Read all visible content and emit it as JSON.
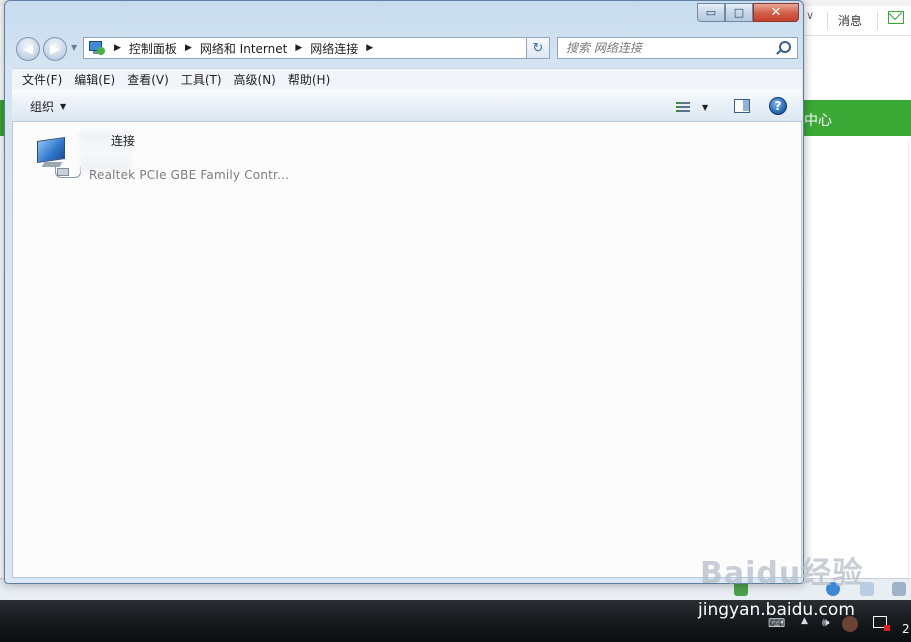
{
  "background": {
    "header_messages": "消息",
    "green_banner_text": "中心",
    "clock_digit": "2",
    "watermark": "Baidu经验",
    "watermark_site": "jingyan.baidu.com"
  },
  "window": {
    "caption": {
      "minimize": "▭",
      "maximize": "□",
      "close": "✕"
    },
    "address": {
      "crumbs": [
        "控制面板",
        "网络和 Internet",
        "网络连接"
      ]
    },
    "search": {
      "placeholder": "搜索 网络连接"
    },
    "menu": [
      "文件(F)",
      "编辑(E)",
      "查看(V)",
      "工具(T)",
      "高级(N)",
      "帮助(H)"
    ],
    "toolbar": {
      "organize_label": "组织",
      "help_label": "?"
    },
    "items": [
      {
        "name": "连接",
        "device": "Realtek PCIe GBE Family Contr..."
      }
    ]
  },
  "colors": {
    "accent_green": "#3aa935",
    "window_frame": "#c7dcef",
    "close_red": "#c4402a"
  },
  "icons": {
    "back": "arrow-left-icon",
    "forward": "arrow-right-icon",
    "refresh": "refresh-icon",
    "search": "search-icon",
    "view": "view-options-icon",
    "preview": "preview-pane-icon",
    "help": "help-icon",
    "network": "network-connection-icon"
  }
}
